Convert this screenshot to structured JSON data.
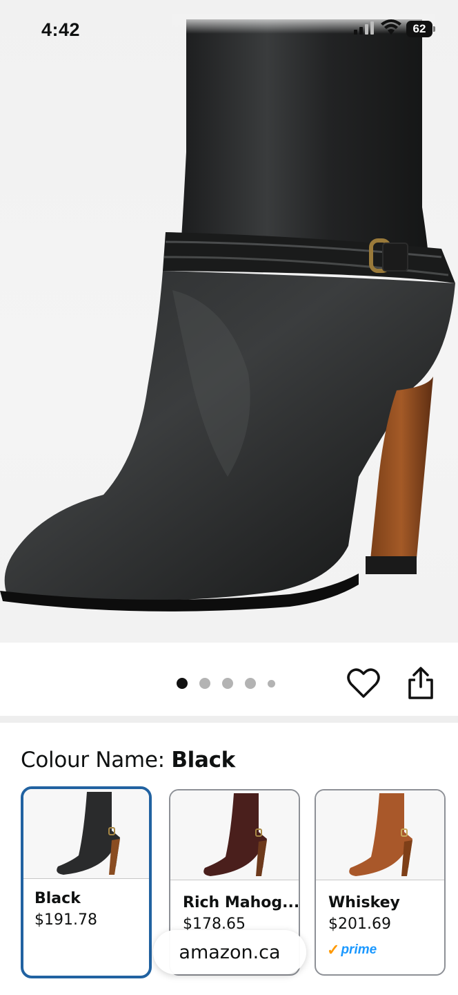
{
  "status_bar": {
    "time": "4:42",
    "battery": "62"
  },
  "product_image": {
    "icon": "ankle-boot-image",
    "dots_count": 5,
    "active_dot": 0
  },
  "actions": {
    "favorite_icon": "heart-icon",
    "share_icon": "share-icon"
  },
  "colour": {
    "label": "Colour Name:",
    "selected": "Black"
  },
  "swatches": [
    {
      "name": "Black",
      "price": "$191.78",
      "color": "#2a2b2c",
      "prime": false
    },
    {
      "name": "Rich Mahog...",
      "price": "$178.65",
      "color": "#4a1f1c",
      "prime": false
    },
    {
      "name": "Whiskey",
      "price": "$201.69",
      "color": "#a9582a",
      "prime": true
    }
  ],
  "prime_label": "prime",
  "browser": {
    "url": "amazon.ca"
  }
}
